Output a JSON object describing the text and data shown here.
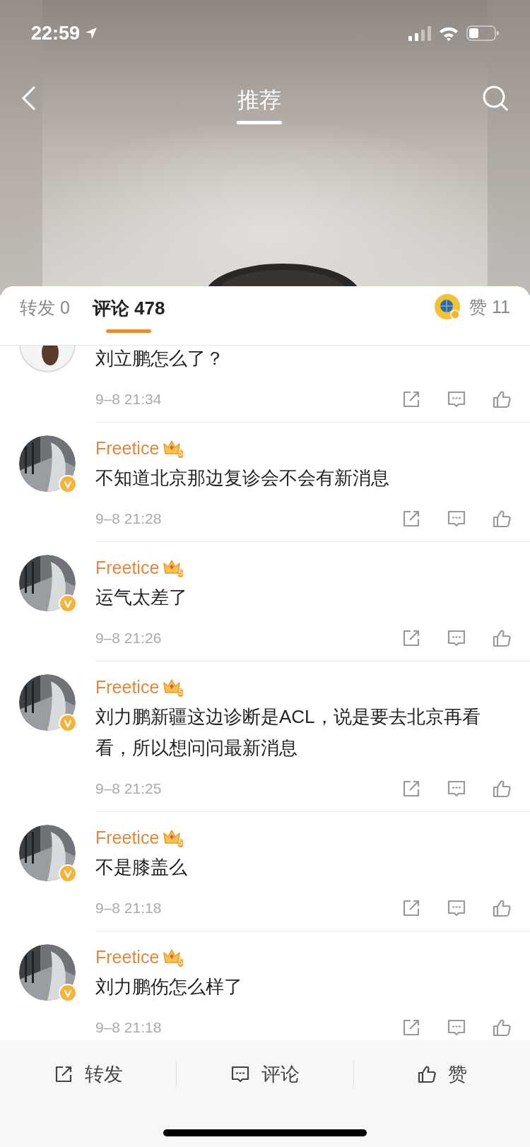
{
  "status_bar": {
    "time": "22:59"
  },
  "nav": {
    "title": "推荐"
  },
  "tabs": [
    {
      "label": "转发",
      "count": "0",
      "selected": false
    },
    {
      "label": "评论",
      "count": "478",
      "selected": true
    }
  ],
  "likes": {
    "label": "赞",
    "count": "11"
  },
  "comments": [
    {
      "partial": true,
      "verified": false,
      "text": "刘立鹏怎么了？",
      "time": "9–8 21:34"
    },
    {
      "partial": false,
      "verified": true,
      "name": "Freetice",
      "badge": "5",
      "text": "不知道北京那边复诊会不会有新消息",
      "time": "9–8 21:28"
    },
    {
      "partial": false,
      "verified": true,
      "name": "Freetice",
      "badge": "5",
      "text": "运气太差了",
      "time": "9–8 21:26"
    },
    {
      "partial": false,
      "verified": true,
      "name": "Freetice",
      "badge": "5",
      "text": "刘力鹏新疆这边诊断是ACL，说是要去北京再看看，所以想问问最新消息",
      "time": "9–8 21:25"
    },
    {
      "partial": false,
      "verified": true,
      "name": "Freetice",
      "badge": "5",
      "text": "不是膝盖么",
      "time": "9–8 21:18"
    },
    {
      "partial": false,
      "verified": true,
      "name": "Freetice",
      "badge": "5",
      "text": "刘力鹏伤怎么样了",
      "time": "9–8 21:18"
    }
  ],
  "bottom_bar": [
    {
      "kind": "repost",
      "label": "转发"
    },
    {
      "kind": "comment",
      "label": "评论"
    },
    {
      "kind": "like",
      "label": "赞"
    }
  ]
}
